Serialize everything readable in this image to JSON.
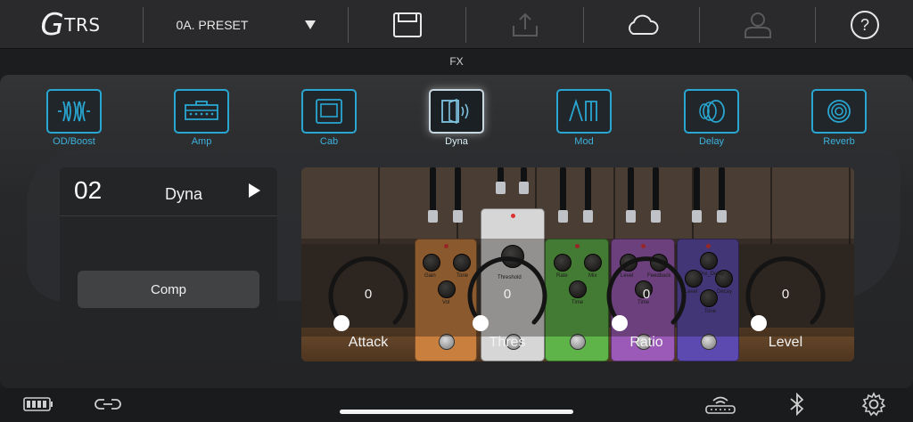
{
  "header": {
    "logo_main": "G",
    "logo_rest": "TRS",
    "preset_name": "0A. PRESET",
    "icons": [
      "save-icon",
      "upload-icon",
      "cloud-icon",
      "account-icon",
      "help-icon"
    ]
  },
  "fx_label": "FX",
  "categories": [
    {
      "label": "OD/Boost",
      "icon": "od-boost-icon"
    },
    {
      "label": "Amp",
      "icon": "amp-icon"
    },
    {
      "label": "Cab",
      "icon": "cab-icon"
    },
    {
      "label": "Dyna",
      "icon": "dyna-icon",
      "active": true
    },
    {
      "label": "Mod",
      "icon": "mod-icon"
    },
    {
      "label": "Delay",
      "icon": "delay-icon"
    },
    {
      "label": "Reverb",
      "icon": "reverb-icon"
    }
  ],
  "effect": {
    "number": "02",
    "name": "Dyna",
    "type_button": "Comp"
  },
  "controls": [
    {
      "label": "Attack",
      "value": "0"
    },
    {
      "label": "Thres",
      "value": "0"
    },
    {
      "label": "Ratio",
      "value": "0"
    },
    {
      "label": "Level",
      "value": "0"
    }
  ],
  "pedals": [
    {
      "color": "#c9803f",
      "knobs": [
        "Gain",
        "Tone",
        "Vol"
      ]
    },
    {
      "color": "#d6d6d6",
      "knobs": [
        "Threshold"
      ]
    },
    {
      "color": "#5eb449",
      "knobs": [
        "Rate",
        "Mix",
        "Time"
      ]
    },
    {
      "color": "#9b59b8",
      "knobs": [
        "Level",
        "Feedback",
        "Time"
      ]
    },
    {
      "color": "#5c4ab0",
      "knobs": [
        "Pre_Delay",
        "Level",
        "Decay",
        "Tone"
      ]
    }
  ],
  "colors": {
    "accent": "#29a7d2",
    "background": "#1c1d1f"
  },
  "footer": {
    "icons": [
      "battery-icon",
      "link-icon",
      "wifi-router-icon",
      "bluetooth-icon",
      "settings-icon"
    ]
  }
}
